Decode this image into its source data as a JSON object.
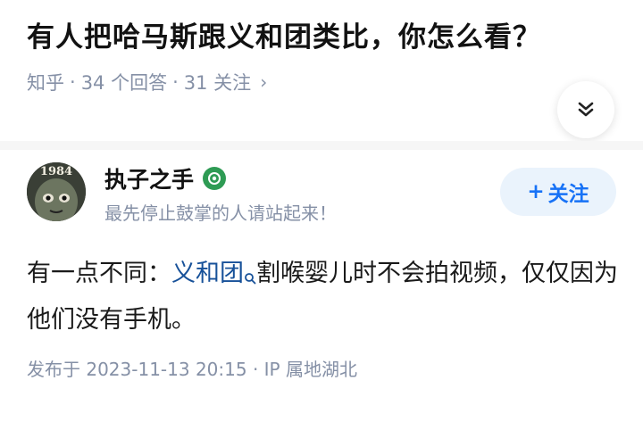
{
  "question": {
    "title": "有人把哈马斯跟义和团类比，你怎么看？",
    "source": "知乎",
    "sep1": "·",
    "answer_count": "34 个回答",
    "sep2": "·",
    "follow_count": "31 关注",
    "chevron": "›"
  },
  "collapse": {
    "icon": "double-chevron-down-icon"
  },
  "author": {
    "avatar_text": "1984",
    "name": "执子之手",
    "bio": "最先停止鼓掌的人请站起来！",
    "badge_icon": "verified-badge-icon"
  },
  "follow_button": {
    "plus": "+",
    "label": "关注"
  },
  "answer": {
    "prefix": "有一点不同：",
    "link_text": "义和团",
    "after_link": "割喉婴儿时不会拍视频，仅仅因为他们没有手机。"
  },
  "publish": {
    "text": "发布于 2023-11-13 20:15 · IP 属地湖北"
  },
  "colors": {
    "accent": "#1772f6",
    "link": "#175199",
    "meta_gray": "#8590a6",
    "badge_green": "#2e9b54"
  }
}
